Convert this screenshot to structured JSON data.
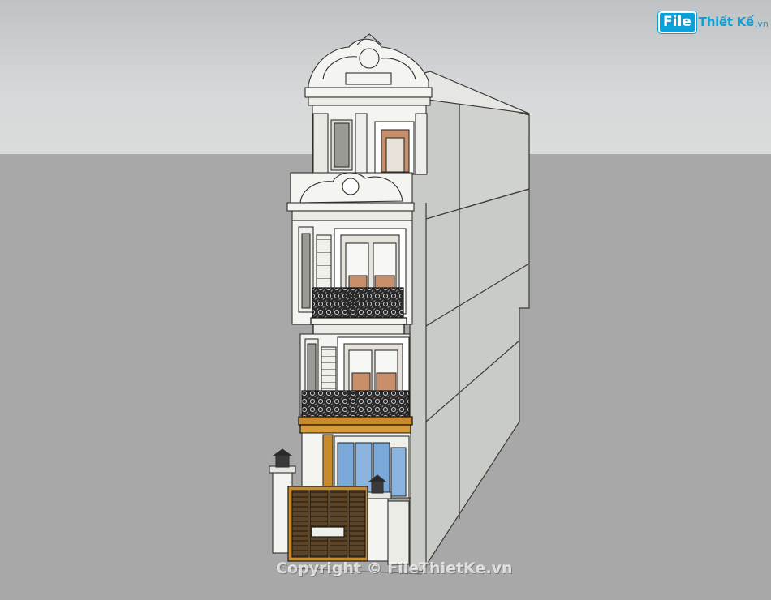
{
  "watermark": {
    "logo_file": "File",
    "logo_rest": "Thiết Kế",
    "logo_tld": ".vn",
    "copyright": "Copyright © FileThietKe.vn"
  },
  "colors": {
    "sky": "#d6d8d9",
    "ground": "#a8a8a8",
    "side_wall": "#c9cbc6",
    "facade": "#f4f4f0",
    "ironwork": "#1c1c1c",
    "wood_trim": "#c98a2c",
    "glass": "#7aa8d8",
    "interior": "#c98f6a",
    "brand_blue": "#0aa0d8"
  }
}
